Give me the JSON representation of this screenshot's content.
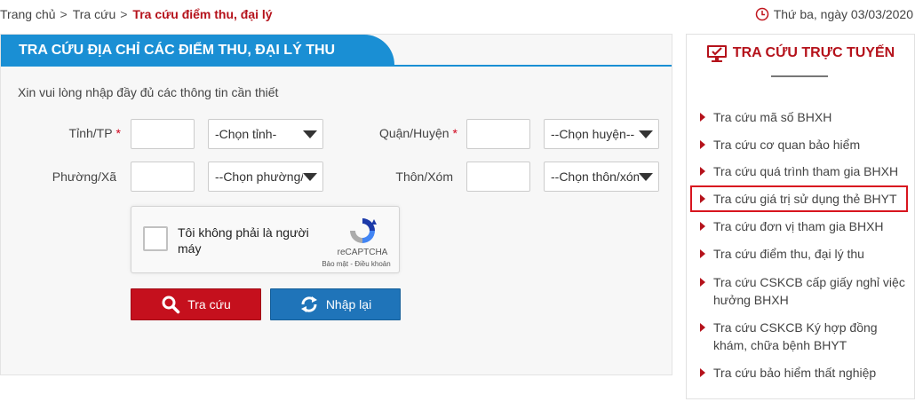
{
  "breadcrumb": {
    "items": [
      "Trang chủ",
      "Tra cứu"
    ],
    "separator": ">",
    "current": "Tra cứu điểm thu, đại lý"
  },
  "date": {
    "icon": "clock-icon",
    "text": "Thứ ba, ngày 03/03/2020"
  },
  "panel": {
    "title": "TRA CỨU ĐỊA CHỈ CÁC ĐIỂM THU, ĐẠI LÝ THU",
    "intro": "Xin vui lòng nhập đầy đủ các thông tin cần thiết",
    "fields": {
      "province": {
        "label": "Tỉnh/TP",
        "required": "*",
        "select": "-Chọn tỉnh-"
      },
      "district": {
        "label": "Quận/Huyện",
        "required": "*",
        "select": "--Chọn huyện--"
      },
      "ward": {
        "label": "Phường/Xã",
        "select": "--Chọn phường/xã--"
      },
      "hamlet": {
        "label": "Thôn/Xóm",
        "select": "--Chọn thôn/xóm--"
      }
    },
    "captcha": {
      "label": "Tôi không phải là người máy",
      "brand": "reCAPTCHA",
      "terms": "Bảo mật - Điều khoản"
    },
    "buttons": {
      "search": "Tra cứu",
      "reset": "Nhập lại"
    }
  },
  "sidebar": {
    "title": "TRA CỨU TRỰC TUYẾN",
    "items": [
      "Tra cứu mã số BHXH",
      "Tra cứu cơ quan bảo hiểm",
      "Tra cứu quá trình tham gia BHXH",
      "Tra cứu giá trị sử dụng thẻ BHYT",
      "Tra cứu đơn vị tham gia BHXH",
      "Tra cứu điểm thu, đại lý thu",
      "Tra cứu CSKCB cấp giấy nghỉ việc hưởng BHXH",
      "Tra cứu CSKCB Ký hợp đồng khám, chữa bệnh BHYT",
      "Tra cứu bảo hiểm thất nghiệp"
    ]
  },
  "colors": {
    "primary_blue": "#1a8fd4",
    "brand_red": "#b5121b",
    "search_button": "#c5101d",
    "reset_button": "#1f74b9"
  }
}
